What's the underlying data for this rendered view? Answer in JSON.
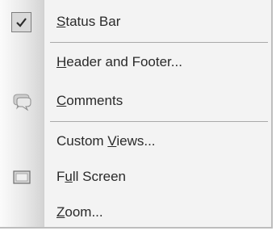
{
  "menu": {
    "items": [
      {
        "pre": "",
        "acc": "S",
        "post": "tatus Bar",
        "icon": "checkmark-icon",
        "checked": true
      },
      {
        "pre": "",
        "acc": "H",
        "post": "eader and Footer...",
        "icon": "",
        "checked": false
      },
      {
        "pre": "",
        "acc": "C",
        "post": "omments",
        "icon": "comments-icon",
        "checked": false
      },
      {
        "pre": "Custom ",
        "acc": "V",
        "post": "iews...",
        "icon": "",
        "checked": false
      },
      {
        "pre": "F",
        "acc": "u",
        "post": "ll Screen",
        "icon": "full-screen-icon",
        "checked": false
      },
      {
        "pre": "",
        "acc": "Z",
        "post": "oom...",
        "icon": "",
        "checked": false
      }
    ]
  }
}
